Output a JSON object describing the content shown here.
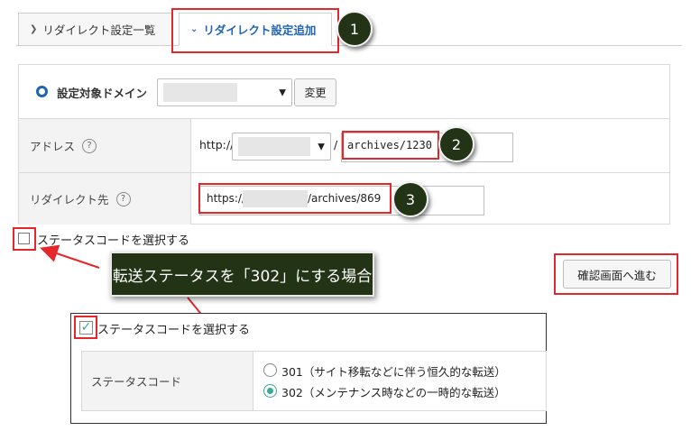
{
  "tabs": [
    {
      "label": "リダイレクト設定一覧",
      "active": false
    },
    {
      "label": "リダイレクト設定追加",
      "active": true
    }
  ],
  "badges": [
    "1",
    "2",
    "3"
  ],
  "form": {
    "domain_label": "設定対象ドメイン",
    "change_button": "変更",
    "address_label": "アドレス",
    "address_prefix": "http://",
    "address_separator": "/",
    "address_path": "archives/1230",
    "redirect_label": "リダイレクト先",
    "redirect_prefix": "https://",
    "redirect_path": "/archives/869",
    "help_glyph": "?"
  },
  "status_checkbox_label": "ステータスコードを選択する",
  "confirm_button": "確認画面へ進む",
  "callout_text": "転送ステータスを「302」にする場合",
  "example": {
    "checkbox_label": "ステータスコードを選択する",
    "status_code_label": "ステータスコード",
    "options": [
      {
        "label": "301（サイト移転などに伴う恒久的な転送）",
        "selected": false
      },
      {
        "label": "302（メンテナンス時などの一時的な転送）",
        "selected": true
      }
    ]
  },
  "colors": {
    "accent": "#1e64b4",
    "highlight": "#e3272d",
    "badge": "#233416",
    "radio_selected": "#3aa999"
  }
}
